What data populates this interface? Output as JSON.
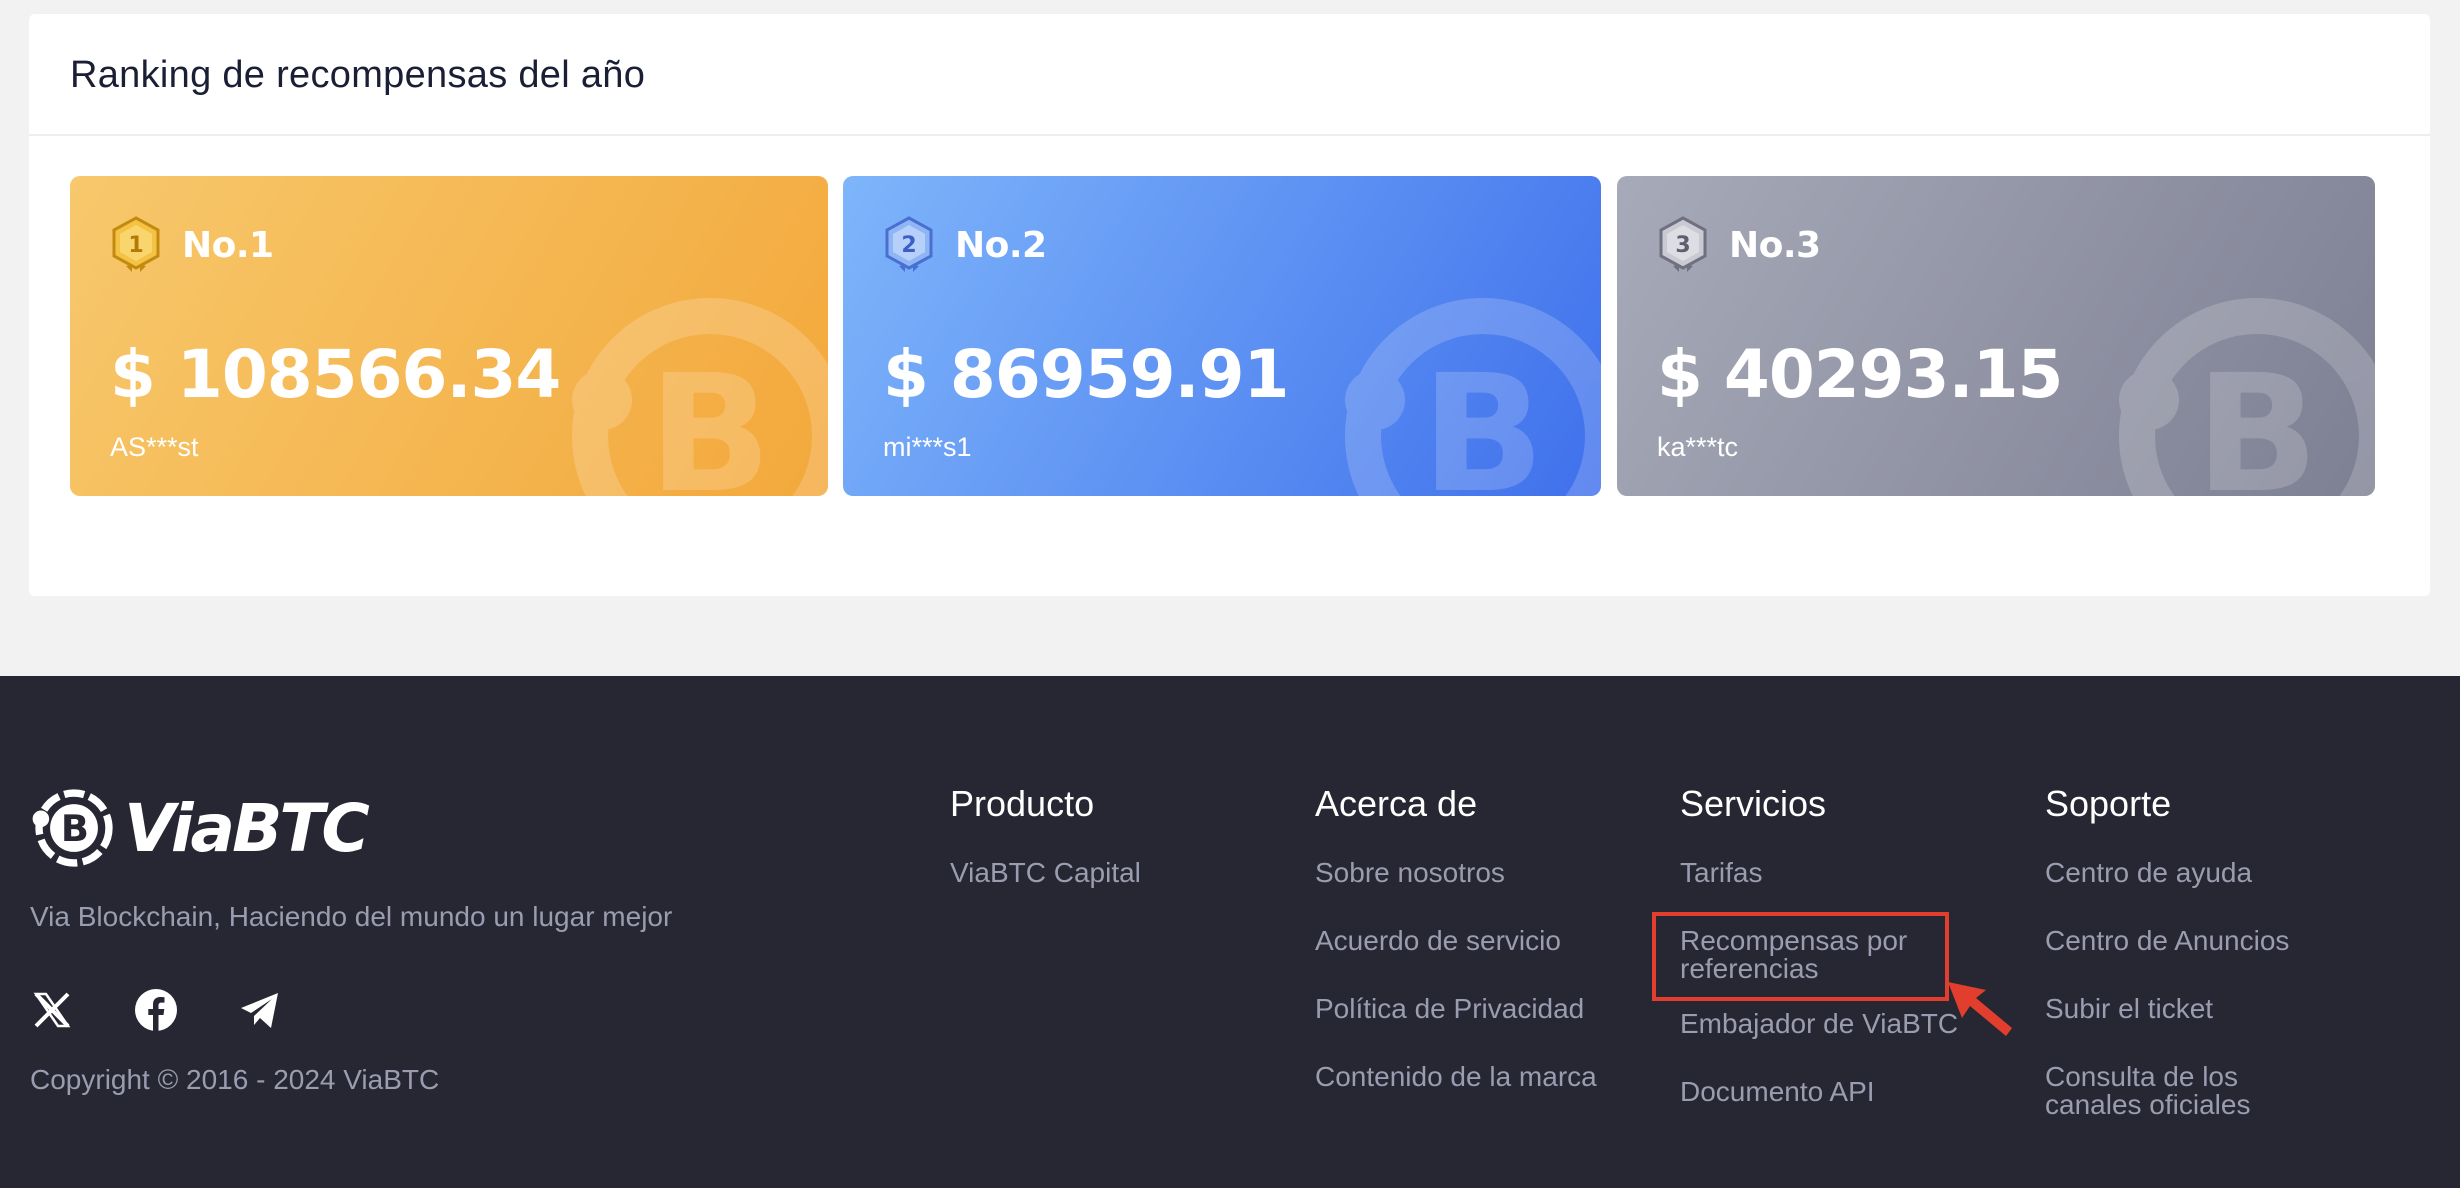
{
  "ranking": {
    "title": "Ranking de recompensas del año",
    "cards": [
      {
        "rank": "No.1",
        "badge": "1",
        "amount": "$ 108566.34",
        "user": "AS***st",
        "color": "#f3a83b"
      },
      {
        "rank": "No.2",
        "badge": "2",
        "amount": "$ 86959.91",
        "user": "mi***s1",
        "color": "#3f70ec"
      },
      {
        "rank": "No.3",
        "badge": "3",
        "amount": "$ 40293.15",
        "user": "ka***tc",
        "color": "#7d7f93"
      }
    ]
  },
  "footer": {
    "brand": "ViaBTC",
    "tagline": "Via Blockchain, Haciendo del mundo un lugar mejor",
    "socials": [
      "x-icon",
      "facebook-icon",
      "telegram-icon"
    ],
    "copyright": "Copyright © 2016 - 2024 ViaBTC",
    "columns": [
      {
        "title": "Producto",
        "links": [
          "ViaBTC Capital"
        ]
      },
      {
        "title": "Acerca de",
        "links": [
          "Sobre nosotros",
          "Acuerdo de servicio",
          "Política de Privacidad",
          "Contenido de la marca"
        ]
      },
      {
        "title": "Servicios",
        "links": [
          "Tarifas",
          "Recompensas por referencias",
          "Embajador de ViaBTC",
          "Documento API"
        ]
      },
      {
        "title": "Soporte",
        "links": [
          "Centro de ayuda",
          "Centro de Anuncios",
          "Subir el ticket",
          "Consulta de los canales oficiales"
        ]
      }
    ]
  },
  "annotation": {
    "color": "#e23e2d"
  }
}
